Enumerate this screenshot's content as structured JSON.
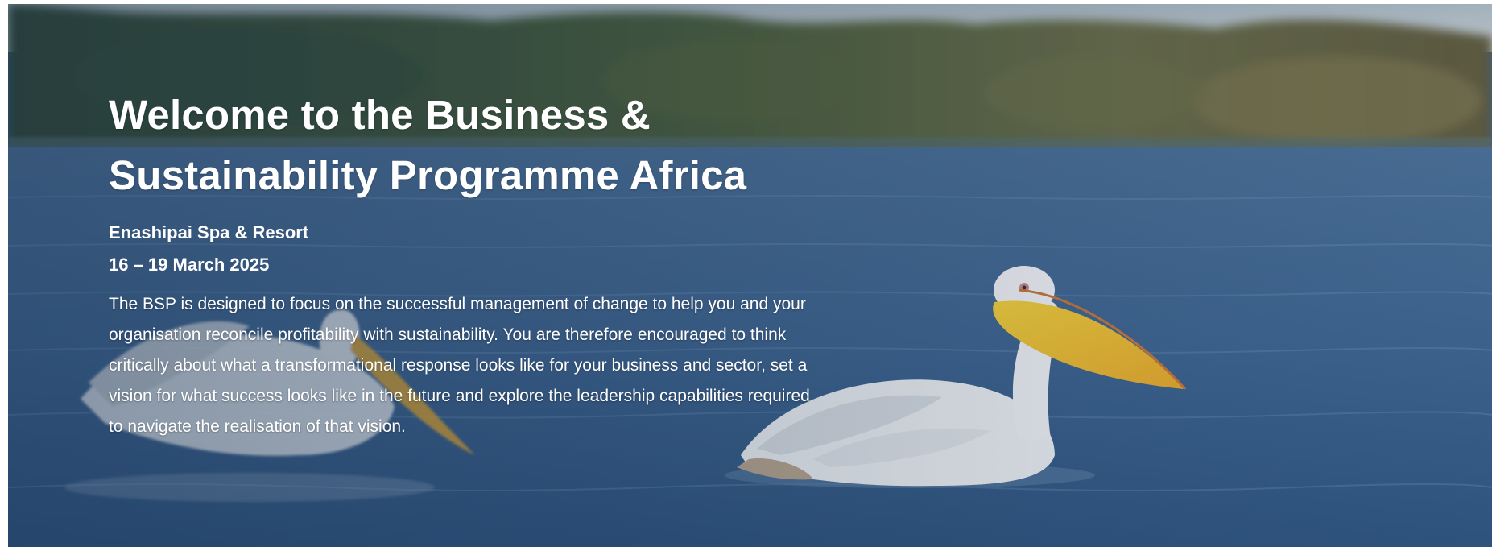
{
  "hero": {
    "title": "Welcome to the Business & Sustainability Programme Africa",
    "venue": "Enashipai Spa & Resort",
    "dates": "16 – 19 March 2025",
    "description": "The BSP is designed to focus on the successful management of change to help you and your organisation reconcile profitability with sustainability. You are therefore encouraged to think critically about what a transformational response looks like for your business and sector, set a vision for what success looks like in the future and explore the leadership capabilities required to navigate the realisation of that vision."
  },
  "colors": {
    "water": "#3d6288",
    "treeline": "#3f5a3c",
    "sky": "#b8c4cc",
    "pelican_body": "#eef1f3",
    "pelican_beak": "#f2c12e",
    "text": "#ffffff"
  }
}
